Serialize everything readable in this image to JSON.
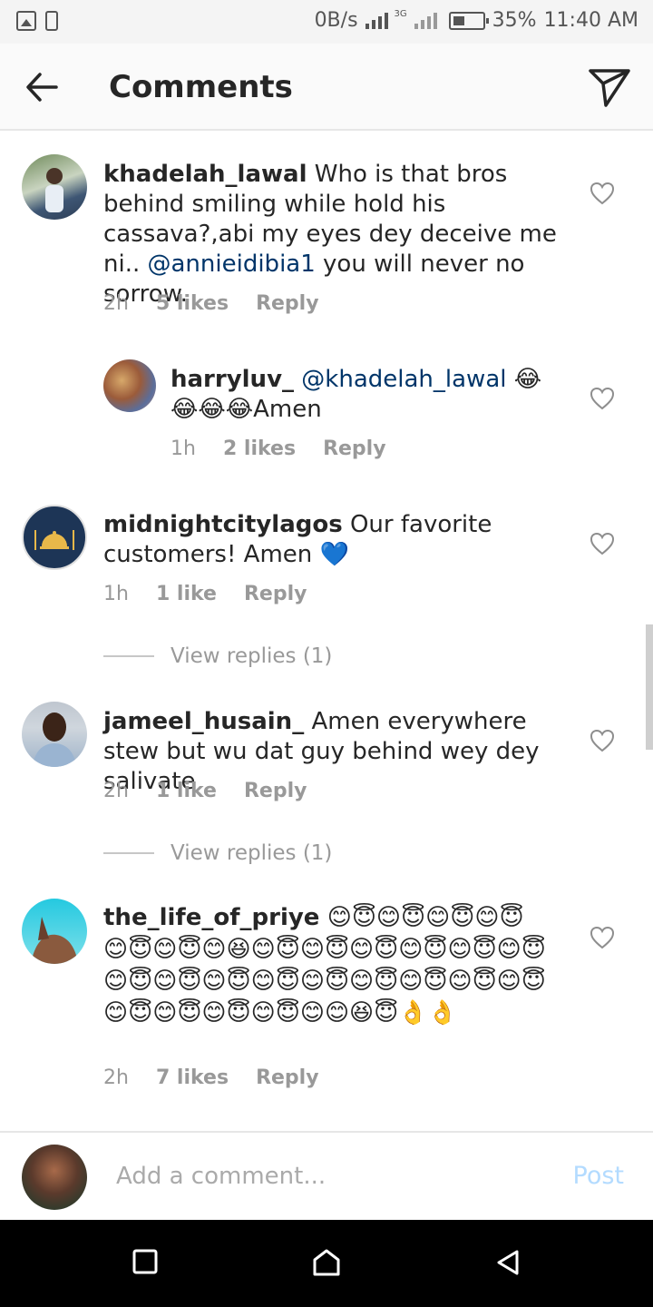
{
  "status_bar": {
    "speed": "0B/s",
    "network": "3G",
    "battery": "35%",
    "time": "11:40 AM"
  },
  "header": {
    "title": "Comments"
  },
  "comments": [
    {
      "username": "khadelah_lawal",
      "text": "Who is that bros behind smiling while hold his cassava?,abi my eyes dey deceive me ni..",
      "mention": "@annieidibia1",
      "text_after": "you will never no sorrow.",
      "time": "2h",
      "likes": "5 likes",
      "reply": "Reply"
    },
    {
      "username": "harryluv_",
      "mention": "@khadelah_lawal",
      "text": "😂😂😂😂Amen",
      "time": "1h",
      "likes": "2 likes",
      "reply": "Reply"
    },
    {
      "username": "midnightcitylagos",
      "text": "Our favorite customers! Amen 💙",
      "time": "1h",
      "likes": "1 like",
      "reply": "Reply",
      "view_replies": "View replies (1)"
    },
    {
      "username": "jameel_husain_",
      "text": "Amen everywhere stew but wu dat guy behind wey dey salivate",
      "time": "2h",
      "likes": "1 like",
      "reply": "Reply",
      "view_replies": "View replies (1)"
    },
    {
      "username": "the_life_of_priye",
      "text": "😊😇😊😇😊😇😊😇😊😇😊😇😊😆😊😇😊😇😊😇😊😇😊😇😊😇😊😇😊😇😊😇😊😇😊😇😊😇😊😇😊😇😊😇😊😇😊😇😊😇😊😇😊😊😆😇👌👌",
      "time": "2h",
      "likes": "7 likes",
      "reply": "Reply"
    }
  ],
  "composer": {
    "placeholder": "Add a comment...",
    "post_label": "Post"
  }
}
